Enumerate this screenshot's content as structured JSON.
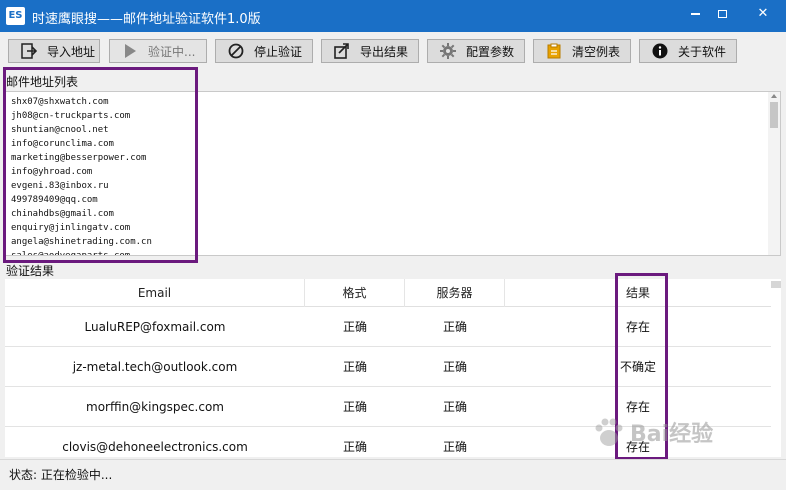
{
  "window": {
    "icon_text": "ES",
    "title": "时速鹰眼搜——邮件地址验证软件1.0版"
  },
  "toolbar": [
    {
      "label": "导入地址",
      "icon": "import-icon",
      "disabled": false
    },
    {
      "label": "验证中...",
      "icon": "play-icon",
      "disabled": true
    },
    {
      "label": "停止验证",
      "icon": "stop-icon",
      "disabled": false
    },
    {
      "label": "导出结果",
      "icon": "export-icon",
      "disabled": false
    },
    {
      "label": "配置参数",
      "icon": "gear-icon",
      "disabled": false
    },
    {
      "label": "清空例表",
      "icon": "clear-icon",
      "disabled": false
    },
    {
      "label": "关于软件",
      "icon": "info-icon",
      "disabled": false
    }
  ],
  "email_list": {
    "label": "邮件地址列表",
    "items": [
      "shx07@shxwatch.com",
      "jh08@cn-truckparts.com",
      "shuntian@cnool.net",
      "info@corunclima.com",
      "marketing@besserpower.com",
      "info@yhroad.com",
      "evgeni.83@inbox.ru",
      "499789409@qq.com",
      "chinahdbs@gmail.com",
      "enquiry@jinlingatv.com",
      "angela@shinetrading.com.cn",
      "sales@aodvegaparts.com"
    ]
  },
  "results": {
    "label": "验证结果",
    "columns": [
      "Email",
      "格式",
      "服务器",
      "结果"
    ],
    "rows": [
      [
        "LualuREP@foxmail.com",
        "正确",
        "正确",
        "存在"
      ],
      [
        "jz-metal.tech@outlook.com",
        "正确",
        "正确",
        "不确定"
      ],
      [
        "morffin@kingspec.com",
        "正确",
        "正确",
        "存在"
      ],
      [
        "clovis@dehoneelectronics.com",
        "正确",
        "正确",
        "存在"
      ]
    ]
  },
  "status": {
    "text": "状态: 正在检验中..."
  },
  "watermark": {
    "text": "Bai经验"
  },
  "colors": {
    "titlebar": "#1a6fc6",
    "highlight": "#6b1a7e"
  }
}
